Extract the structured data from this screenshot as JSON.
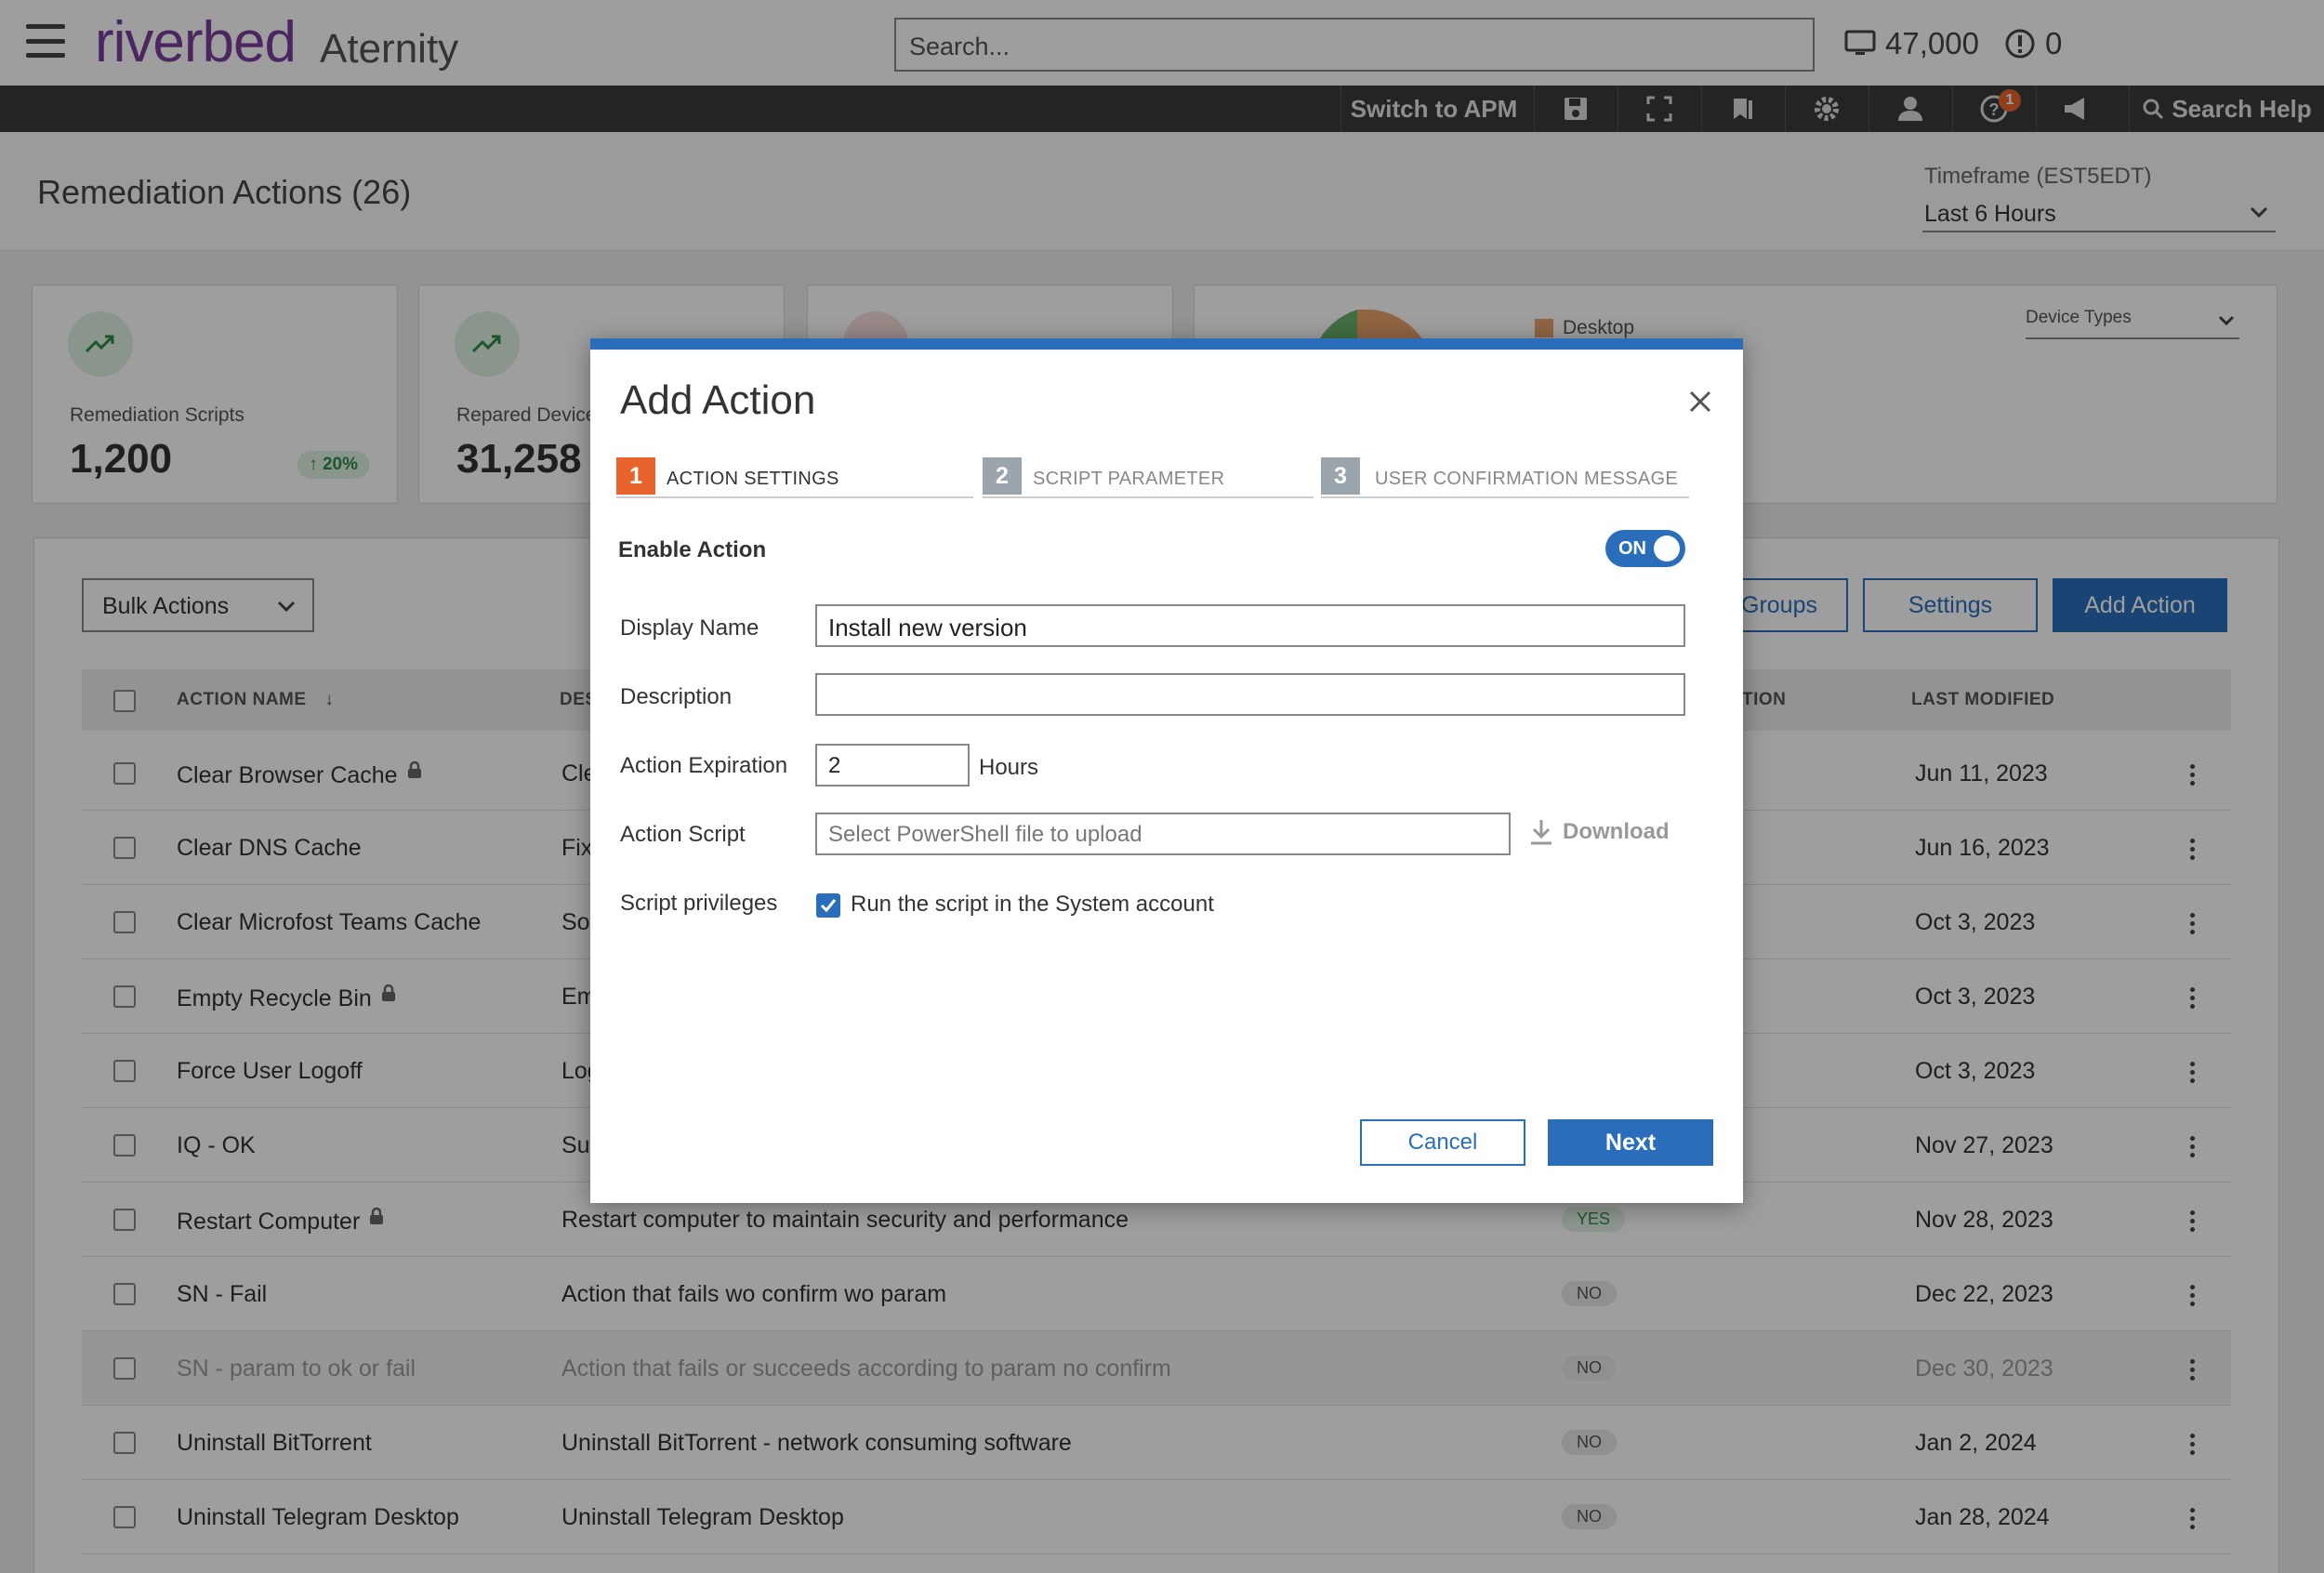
{
  "header": {
    "logo": "riverbed",
    "logo_sub": "Aternity",
    "search_placeholder": "Search...",
    "devices_count": "47,000",
    "alerts_count": "0"
  },
  "toolbar": {
    "switch_apm": "Switch to APM",
    "help_badge": "1",
    "search_help": "Search Help"
  },
  "page": {
    "title": "Remediation Actions (26)",
    "timeframe_label": "Timeframe (EST5EDT)",
    "timeframe_value": "Last 6 Hours"
  },
  "cards": [
    {
      "label": "Remediation Scripts",
      "value": "1,200",
      "trend": "20%"
    },
    {
      "label": "Repared Devices",
      "value": "31,258"
    },
    {
      "legend": "Desktop",
      "select": "Device Types"
    }
  ],
  "table_actions": {
    "bulk": "Bulk Actions",
    "groups": "Groups",
    "settings": "Settings",
    "add": "Add Action"
  },
  "table": {
    "headers": [
      "ACTION NAME",
      "DES",
      "TION",
      "LAST MODIFIED"
    ],
    "rows": [
      {
        "name": "Clear Browser Cache",
        "desc": "Cle",
        "locked": true,
        "confirm": "",
        "modified": "Jun 11, 2023"
      },
      {
        "name": "Clear DNS Cache",
        "desc": "Fix",
        "locked": false,
        "confirm": "",
        "modified": "Jun 16, 2023"
      },
      {
        "name": "Clear Microfost Teams Cache",
        "desc": "Sol",
        "locked": false,
        "confirm": "",
        "modified": "Oct 3, 2023"
      },
      {
        "name": "Empty Recycle Bin",
        "desc": "Em",
        "locked": true,
        "confirm": "",
        "modified": "Oct 3, 2023"
      },
      {
        "name": "Force User Logoff",
        "desc": "Log",
        "locked": false,
        "confirm": "",
        "modified": "Oct 3, 2023"
      },
      {
        "name": "IQ - OK",
        "desc": "Suc",
        "locked": false,
        "confirm": "",
        "modified": "Nov 27, 2023"
      },
      {
        "name": "Restart Computer",
        "desc": "Restart computer to maintain security and performance",
        "locked": true,
        "confirm": "YES",
        "modified": "Nov 28, 2023"
      },
      {
        "name": "SN - Fail",
        "desc": "Action that fails wo confirm wo param",
        "locked": false,
        "confirm": "NO",
        "modified": "Dec 22, 2023"
      },
      {
        "name": "SN - param to ok or fail",
        "desc": "Action that fails or succeeds according to param no confirm",
        "locked": false,
        "confirm": "NO",
        "modified": "Dec 30, 2023",
        "dim": true
      },
      {
        "name": "Uninstall BitTorrent",
        "desc": "Uninstall BitTorrent - network consuming software",
        "locked": false,
        "confirm": "NO",
        "modified": "Jan 2, 2024"
      },
      {
        "name": "Uninstall Telegram Desktop",
        "desc": "Uninstall Telegram Desktop",
        "locked": false,
        "confirm": "NO",
        "modified": "Jan 28, 2024"
      }
    ]
  },
  "modal": {
    "title": "Add Action",
    "steps": [
      {
        "num": "1",
        "label": "ACTION SETTINGS",
        "active": true
      },
      {
        "num": "2",
        "label": "SCRIPT PARAMETER",
        "active": false
      },
      {
        "num": "3",
        "label": "USER CONFIRMATION MESSAGE",
        "active": false
      }
    ],
    "enable_label": "Enable Action",
    "toggle_state": "ON",
    "display_name_label": "Display Name",
    "display_name_value": "Install new version",
    "description_label": "Description",
    "description_value": "",
    "expiration_label": "Action Expiration",
    "expiration_value": "2",
    "expiration_unit": "Hours",
    "script_label": "Action Script",
    "script_placeholder": "Select PowerShell file to upload",
    "download_label": "Download",
    "privileges_label": "Script privileges",
    "privileges_checkbox": "Run the script in the System account",
    "cancel": "Cancel",
    "next": "Next"
  },
  "colors": {
    "accent": "#2a6ebb",
    "step_active": "#e8642c",
    "step_inactive": "#9aa5ad",
    "overlay": "rgba(0,0,0,0.38)"
  }
}
